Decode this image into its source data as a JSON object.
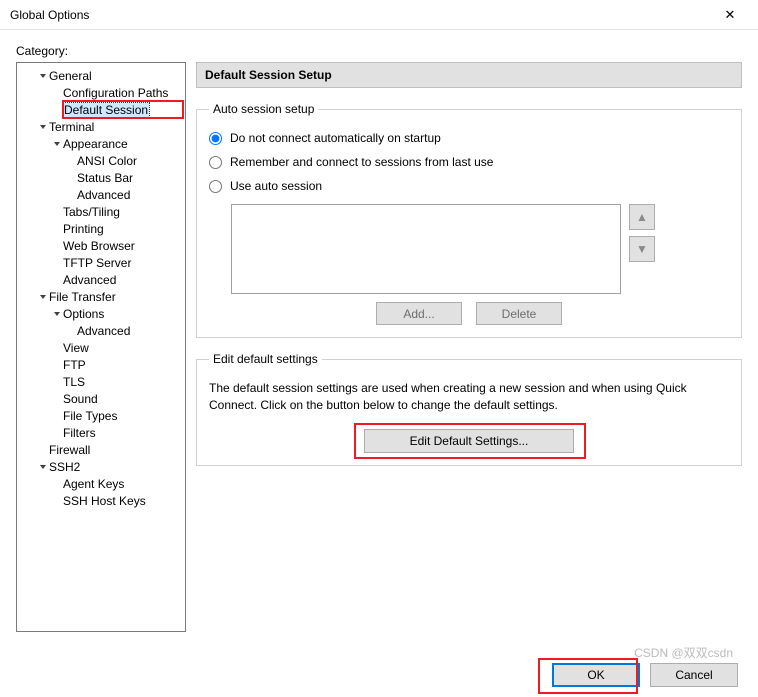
{
  "window": {
    "title": "Global Options",
    "close_glyph": "✕"
  },
  "category_label": "Category:",
  "tree": [
    {
      "label": "General",
      "indent": 1,
      "chevron": "down"
    },
    {
      "label": "Configuration Paths",
      "indent": 2
    },
    {
      "label": "Default Session",
      "indent": 2,
      "selected": true,
      "highlighted": true
    },
    {
      "label": "Terminal",
      "indent": 1,
      "chevron": "down"
    },
    {
      "label": "Appearance",
      "indent": 2,
      "chevron": "down"
    },
    {
      "label": "ANSI Color",
      "indent": 3
    },
    {
      "label": "Status Bar",
      "indent": 3
    },
    {
      "label": "Advanced",
      "indent": 3
    },
    {
      "label": "Tabs/Tiling",
      "indent": 2
    },
    {
      "label": "Printing",
      "indent": 2
    },
    {
      "label": "Web Browser",
      "indent": 2
    },
    {
      "label": "TFTP Server",
      "indent": 2
    },
    {
      "label": "Advanced",
      "indent": 2
    },
    {
      "label": "File Transfer",
      "indent": 1,
      "chevron": "down"
    },
    {
      "label": "Options",
      "indent": 2,
      "chevron": "down"
    },
    {
      "label": "Advanced",
      "indent": 3
    },
    {
      "label": "View",
      "indent": 2
    },
    {
      "label": "FTP",
      "indent": 2
    },
    {
      "label": "TLS",
      "indent": 2
    },
    {
      "label": "Sound",
      "indent": 2
    },
    {
      "label": "File Types",
      "indent": 2
    },
    {
      "label": "Filters",
      "indent": 2
    },
    {
      "label": "Firewall",
      "indent": 1
    },
    {
      "label": "SSH2",
      "indent": 1,
      "chevron": "down"
    },
    {
      "label": "Agent Keys",
      "indent": 2
    },
    {
      "label": "SSH Host Keys",
      "indent": 2
    }
  ],
  "main": {
    "section_title": "Default Session Setup",
    "auto_session": {
      "legend": "Auto session setup",
      "radios": {
        "do_not_connect": "Do not connect automatically on startup",
        "remember": "Remember and connect to sessions from last use",
        "use_auto": "Use auto session"
      },
      "selected": "do_not_connect",
      "add_label": "Add...",
      "delete_label": "Delete",
      "up_glyph": "▲",
      "down_glyph": "▼"
    },
    "edit_defaults": {
      "legend": "Edit default settings",
      "description": "The default session settings are used when creating a new session and when using Quick Connect.  Click on the button below to change the default settings.",
      "button_label": "Edit Default Settings..."
    }
  },
  "footer": {
    "ok_label": "OK",
    "cancel_label": "Cancel"
  },
  "watermark": "CSDN @双双csdn"
}
